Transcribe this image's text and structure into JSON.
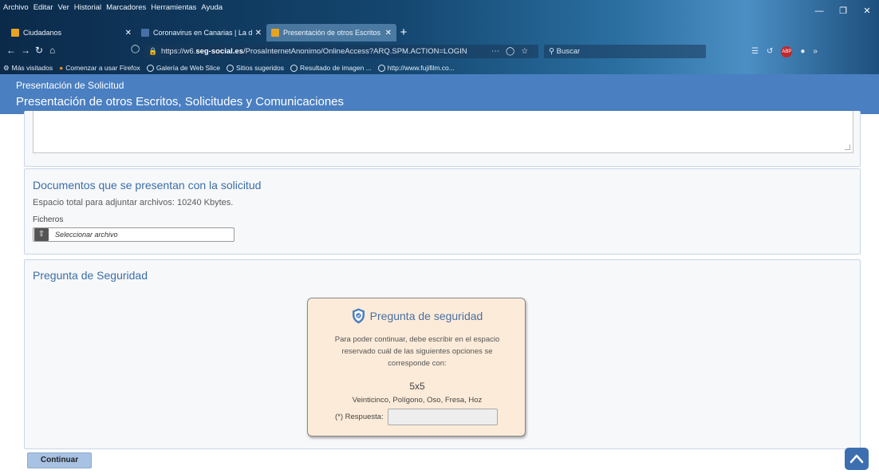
{
  "browser": {
    "menu": [
      "Archivo",
      "Editar",
      "Ver",
      "Historial",
      "Marcadores",
      "Herramientas",
      "Ayuda"
    ],
    "tabs": [
      {
        "title": "Ciudadanos",
        "favicon_color": "#e9a323"
      },
      {
        "title": "Coronavirus en Canarias | La d",
        "favicon_color": "#4a6fa8"
      },
      {
        "title": "Presentación de otros Escritos",
        "favicon_color": "#e9a323"
      }
    ],
    "url_prefix": "https://w6.",
    "url_domain": "seg-social.es",
    "url_rest": "/ProsaInternetAnonimo/OnlineAccess?ARQ.SPM.ACTION=LOGIN",
    "search_placeholder": "Buscar",
    "bookmarks": [
      "Más visitados",
      "Comenzar a usar Firefox",
      "Galería de Web Slice",
      "Sitios sugeridos",
      "Resultado de imagen ...",
      "http://www.fujifilm.co..."
    ]
  },
  "header": {
    "subtitle": "Presentación de Solicitud",
    "title": "Presentación de otros Escritos, Solicitudes y Comunicaciones"
  },
  "documents": {
    "title": "Documentos que se presentan con la solicitud",
    "space_text": "Espacio total para adjuntar archivos: 10240 Kbytes.",
    "files_label": "Ficheros",
    "file_placeholder": "Seleccionar archivo"
  },
  "security": {
    "section_title": "Pregunta de Seguridad",
    "box_title": "Pregunta de seguridad",
    "description": "Para poder continuar, debe escribir en el espacio reservado cuál de las siguientes opciones se corresponde con:",
    "question": "5x5",
    "options": "Veinticinco, Polígono, Oso, Fresa, Hoz",
    "answer_label": "(*) Respuesta:",
    "answer_value": ""
  },
  "actions": {
    "continue_label": "Continuar"
  }
}
